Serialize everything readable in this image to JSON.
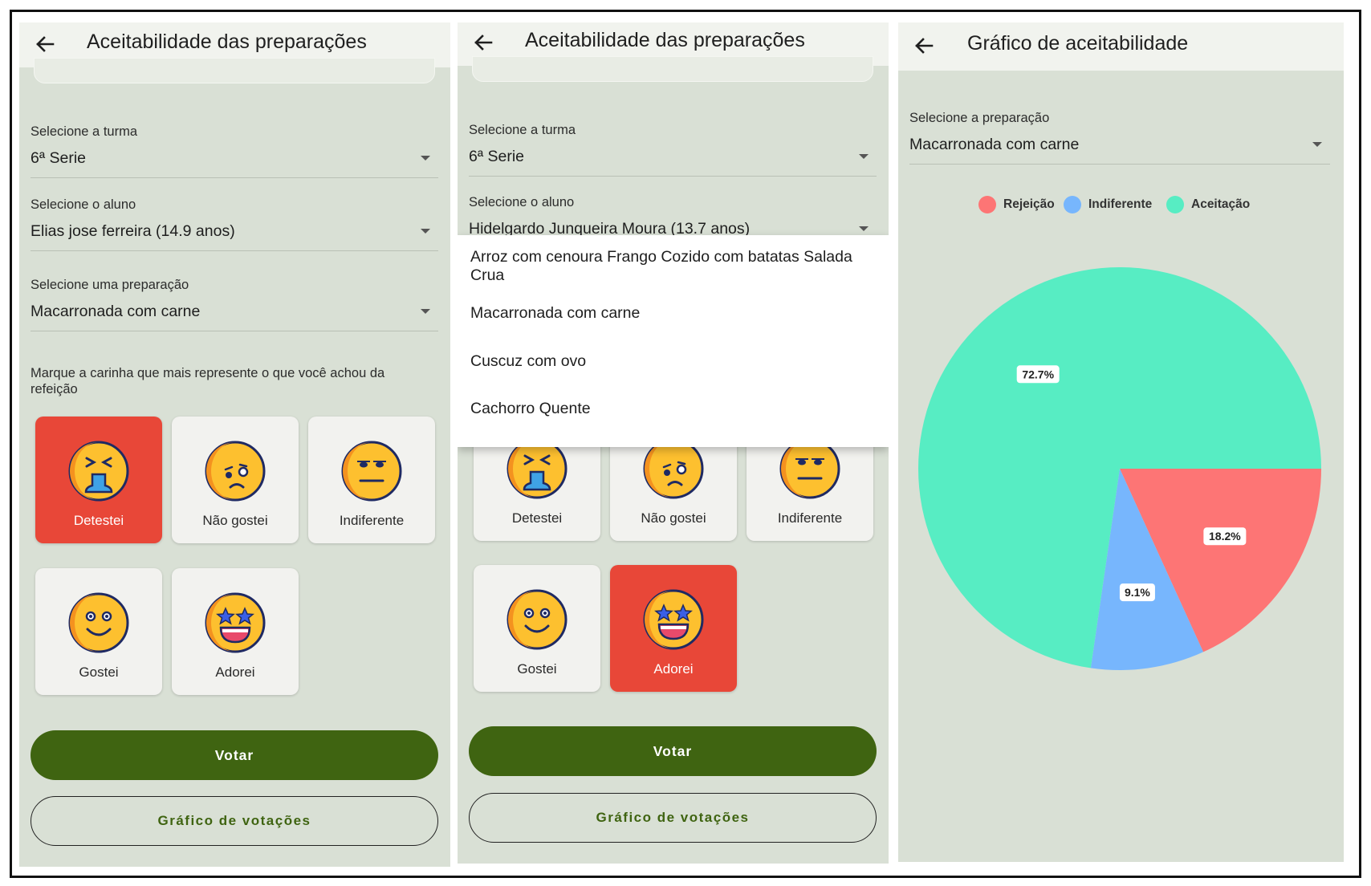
{
  "screen1": {
    "title": "Aceitabilidade das preparações",
    "turma_label": "Selecione a turma",
    "turma_value": "6ª Serie",
    "aluno_label": "Selecione o aluno",
    "aluno_value": "Elias jose ferreira (14.9 anos)",
    "prep_label": "Selecione uma preparação",
    "prep_value": "Macarronada com carne",
    "instruction": "Marque a carinha que mais represente o que você achou da refeição",
    "options": [
      {
        "label": "Detestei",
        "icon": "disgusted-face-icon",
        "selected": true
      },
      {
        "label": "Não gostei",
        "icon": "sad-face-icon",
        "selected": false
      },
      {
        "label": "Indiferente",
        "icon": "neutral-face-icon",
        "selected": false
      },
      {
        "label": "Gostei",
        "icon": "smiling-face-icon",
        "selected": false
      },
      {
        "label": "Adorei",
        "icon": "star-struck-face-icon",
        "selected": false
      }
    ],
    "vote_button": "Votar",
    "chart_button": "Gráfico de votações"
  },
  "screen2": {
    "title": "Aceitabilidade das preparações",
    "turma_label": "Selecione a turma",
    "turma_value": "6ª Serie",
    "aluno_label": "Selecione o aluno",
    "aluno_value": "Hidelgardo Junqueira Moura (13.7 anos)",
    "dropdown_options": [
      "Arroz com cenoura Frango Cozido com batatas Salada Crua",
      "Macarronada com carne",
      "Cuscuz com ovo",
      "Cachorro Quente"
    ],
    "options": [
      {
        "label": "Detestei",
        "icon": "disgusted-face-icon",
        "selected": false
      },
      {
        "label": "Não gostei",
        "icon": "sad-face-icon",
        "selected": false
      },
      {
        "label": "Indiferente",
        "icon": "neutral-face-icon",
        "selected": false
      },
      {
        "label": "Gostei",
        "icon": "smiling-face-icon",
        "selected": false
      },
      {
        "label": "Adorei",
        "icon": "star-struck-face-icon",
        "selected": true
      }
    ],
    "vote_button": "Votar",
    "chart_button": "Gráfico de votações"
  },
  "screen3": {
    "title": "Gráfico de aceitabilidade",
    "prep_label": "Selecione a preparação",
    "prep_value": "Macarronada com carne"
  },
  "colors": {
    "background": "#d9e0d5",
    "appbar": "#f1f3ee",
    "primary": "#3f6411",
    "selected_tile": "#e84738",
    "emoji_face": "#fdc02f",
    "emoji_outline": "#1f2a63"
  },
  "chart_data": {
    "type": "pie",
    "legend_position": "top",
    "series": [
      {
        "name": "Rejeição",
        "value": 18.2,
        "label": "18.2%",
        "color": "#fd7575"
      },
      {
        "name": "Indiferente",
        "value": 9.1,
        "label": "9.1%",
        "color": "#77b6fd"
      },
      {
        "name": "Aceitação",
        "value": 72.7,
        "label": "72.7%",
        "color": "#57edc3"
      }
    ]
  }
}
